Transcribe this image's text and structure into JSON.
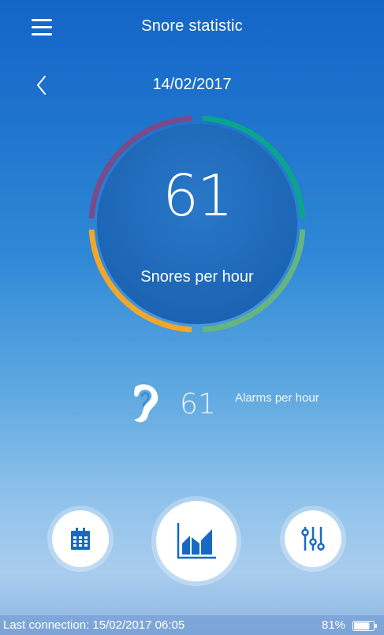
{
  "header": {
    "title": "Snore statistic",
    "menu_icon": "hamburger-menu-icon"
  },
  "date_nav": {
    "date": "14/02/2017",
    "back_icon": "chevron-left-icon"
  },
  "gauge": {
    "value": "61",
    "caption": "Snores per hour",
    "segment_colors": [
      "#0aa48f",
      "#67b57e",
      "#f0a72a",
      "#7a4b8a"
    ]
  },
  "alarms": {
    "icon": "ear-icon",
    "value": "61",
    "label": "Alarms per hour"
  },
  "bottom_nav": {
    "calendar_icon": "calendar-icon",
    "statistics_icon": "bar-chart-icon",
    "settings_icon": "sliders-icon",
    "icon_color": "#1769c4"
  },
  "status": {
    "last_connection": "Last connection: 15/02/2017 06:05",
    "battery_percent": "81%",
    "battery_level": 0.81
  }
}
